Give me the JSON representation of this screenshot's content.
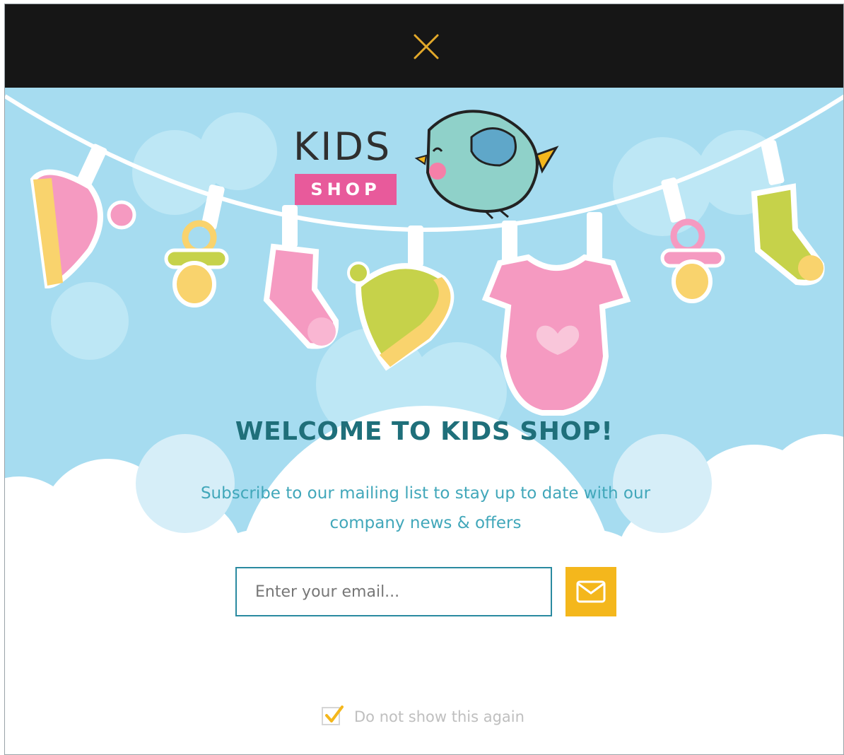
{
  "popup": {
    "close_icon": "close-icon",
    "accent_color": "#f4b71c",
    "logo": {
      "line1": "KIDS",
      "line2": "SHOP"
    },
    "title": "WELCOME TO KIDS SHOP!",
    "subtitle": "Subscribe to our mailing list to stay up to date with our company news & offers",
    "email_placeholder": "Enter your email...",
    "submit_icon": "envelope-icon",
    "optout_label": "Do not show this again",
    "optout_checked": true
  }
}
